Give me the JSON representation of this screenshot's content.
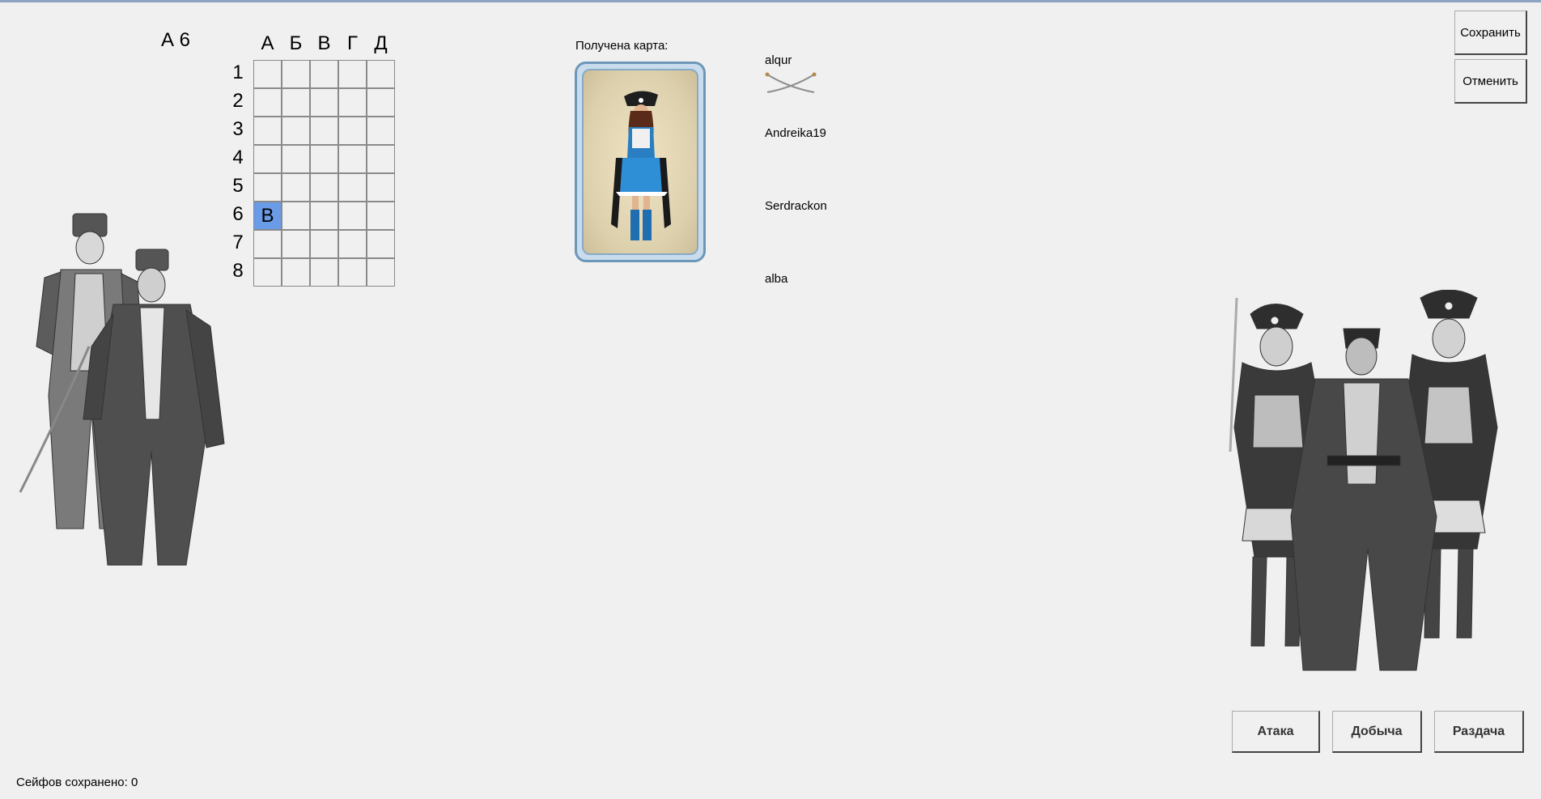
{
  "coordinate": "А 6",
  "grid": {
    "columns": [
      "А",
      "Б",
      "В",
      "Г",
      "Д"
    ],
    "rows": [
      "1",
      "2",
      "3",
      "4",
      "5",
      "6",
      "7",
      "8"
    ],
    "marked_cell": {
      "row": "6",
      "column": "А",
      "value": "В"
    }
  },
  "card": {
    "caption": "Получена карта:",
    "image": "pirate-woman-card"
  },
  "players": [
    {
      "name": "alqur",
      "icon": "crossed-sabers-icon"
    },
    {
      "name": "Andreika19"
    },
    {
      "name": "Serdrackon"
    },
    {
      "name": "alba"
    }
  ],
  "buttons": {
    "save": "Сохранить",
    "cancel": "Отменить",
    "attack": "Атака",
    "loot": "Добыча",
    "deal": "Раздача"
  },
  "status": "Сейфов сохранено: 0",
  "icons": {
    "left": "officers-illustration",
    "right": "pirates-illustration"
  },
  "colors": {
    "active_cell": "#6a9be6",
    "card_border": "#6d97b8",
    "background": "#f0f0f0"
  }
}
